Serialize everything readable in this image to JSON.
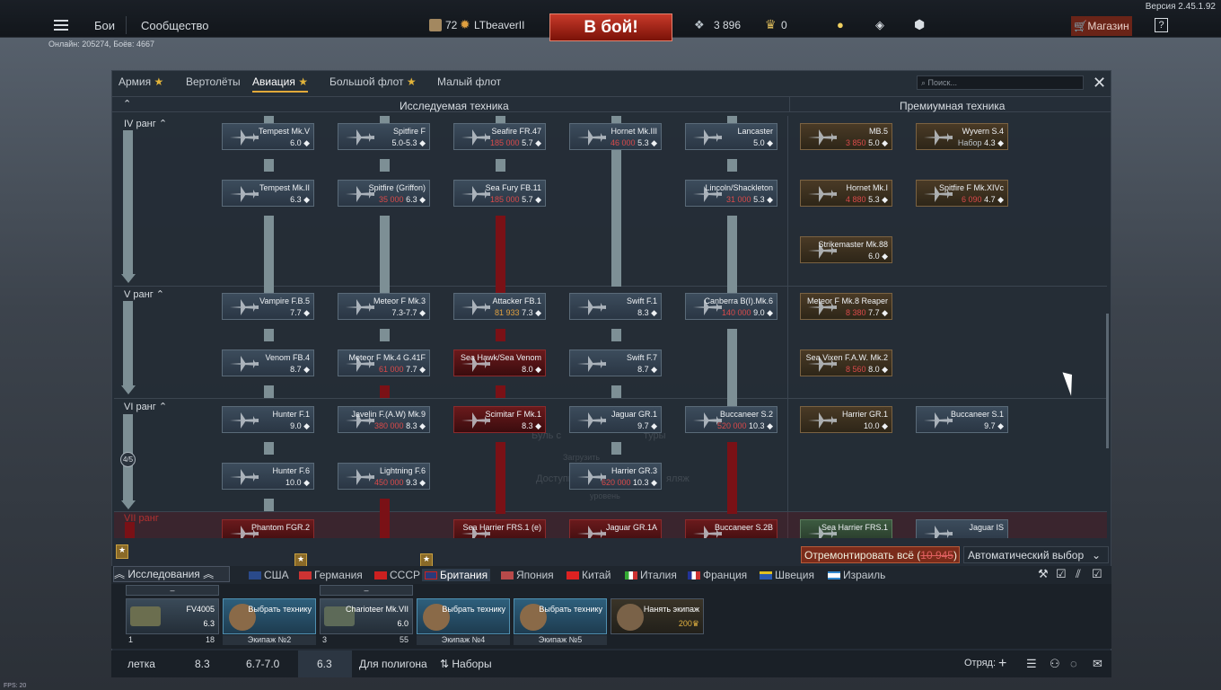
{
  "version": "Версия 2.45.1.92",
  "online": "Онлайн: 205274, Боёв: 4667",
  "topbar": {
    "battles": "Бои",
    "community": "Сообщество",
    "level": "72",
    "username": "LTbeaverII",
    "battle_button": "В бой!",
    "silver": "3 896",
    "golden_eagles": "0",
    "shop": "Магазин",
    "help": "?"
  },
  "tabs": [
    {
      "label": "Армия"
    },
    {
      "label": "Вертолёты"
    },
    {
      "label": "Авиация"
    },
    {
      "label": "Большой флот"
    },
    {
      "label": "Малый флот"
    }
  ],
  "search_placeholder": "Поиск...",
  "headers": {
    "research": "Исследуемая техника",
    "premium": "Премиумная техника"
  },
  "ranks": [
    "IV ранг",
    "V ранг",
    "VI ранг",
    "VII ранг"
  ],
  "rank_progress": "4/5",
  "cards": [
    {
      "name": "Tempest Mk.V",
      "br": "6.0 ◆"
    },
    {
      "name": "Spitfire F",
      "br": "5.0-5.3 ◆"
    },
    {
      "name": "Seafire FR.47",
      "price": "185 000",
      "br": "5.7 ◆"
    },
    {
      "name": "Hornet Mk.III",
      "price": "46 000",
      "br": "5.3 ◆"
    },
    {
      "name": "Lancaster",
      "br": "5.0 ◆"
    },
    {
      "name": "Tempest Mk.II",
      "br": "6.3 ◆"
    },
    {
      "name": "Spitfire (Griffon)",
      "price": "35 000",
      "br": "6.3 ◆"
    },
    {
      "name": "Sea Fury FB.11",
      "price": "185 000",
      "br": "5.7 ◆"
    },
    {
      "name": "Lincoln/Shackleton",
      "price": "31 000",
      "br": "5.3 ◆"
    },
    {
      "name": "Vampire F.B.5",
      "br": "7.7 ◆"
    },
    {
      "name": "Meteor F Mk.3",
      "br": "7.3-7.7 ◆"
    },
    {
      "name": "Attacker FB.1",
      "price": "81 933",
      "br": "7.3 ◆"
    },
    {
      "name": "Swift F.1",
      "br": "8.3 ◆"
    },
    {
      "name": "Canberra B(I).Mk.6",
      "price": "140 000",
      "br": "9.0 ◆"
    },
    {
      "name": "Venom FB.4",
      "br": "8.7 ◆"
    },
    {
      "name": "Meteor F Mk.4 G.41F",
      "price": "61 000",
      "br": "7.7 ◆"
    },
    {
      "name": "Sea Hawk/Sea Venom",
      "br": "8.0 ◆"
    },
    {
      "name": "Swift F.7",
      "br": "8.7 ◆"
    },
    {
      "name": "Hunter F.1",
      "br": "9.0 ◆"
    },
    {
      "name": "Javelin F.(A.W) Mk.9",
      "price": "380 000",
      "br": "8.3 ◆"
    },
    {
      "name": "Scimitar F Mk.1",
      "br": "8.3 ◆"
    },
    {
      "name": "Jaguar GR.1",
      "br": "9.7 ◆"
    },
    {
      "name": "Buccaneer S.2",
      "price": "520 000",
      "br": "10.3 ◆"
    },
    {
      "name": "Hunter F.6",
      "br": "10.0 ◆"
    },
    {
      "name": "Lightning F.6",
      "price": "450 000",
      "br": "9.3 ◆"
    },
    {
      "name": "Harrier GR.3",
      "price": "620 000",
      "br": "10.3 ◆"
    },
    {
      "name": "Phantom FGR.2"
    },
    {
      "name": "Sea Harrier FRS.1 (e)"
    },
    {
      "name": "Jaguar GR.1A"
    },
    {
      "name": "Buccaneer S.2B"
    }
  ],
  "premium_cards": [
    {
      "name": "MB.5",
      "price": "3 850",
      "br": "5.0 ◆"
    },
    {
      "name": "Wyvern S.4",
      "price": "Набор",
      "br": "4.3 ◆"
    },
    {
      "name": "Hornet Mk.I",
      "price": "4 880",
      "br": "5.3 ◆"
    },
    {
      "name": "Spitfire F Mk.XIVc",
      "price": "6 090",
      "br": "4.7 ◆"
    },
    {
      "name": "Strikemaster Mk.88",
      "br": "6.0 ◆"
    },
    {
      "name": "Meteor F Mk.8 Reaper",
      "price": "8 380",
      "br": "7.7 ◆"
    },
    {
      "name": "Sea Vixen F.A.W. Mk.2",
      "price": "8 560",
      "br": "8.0 ◆"
    },
    {
      "name": "Harrier GR.1",
      "br": "10.0 ◆"
    },
    {
      "name": "Buccaneer S.1",
      "br": "9.7 ◆"
    },
    {
      "name": "Sea Harrier FRS.1"
    },
    {
      "name": "Jaguar IS"
    }
  ],
  "ghost_text": [
    "Буль с",
    "туры",
    "Загрузить",
    "Доступно",
    "яляж",
    "уровень"
  ],
  "repair": "Отремонтировать всё",
  "repair_cost": "10 945",
  "auto_select": "Автоматический выбор",
  "research_label": "Исследования",
  "nations": [
    {
      "label": "США"
    },
    {
      "label": "Германия"
    },
    {
      "label": "СССР"
    },
    {
      "label": "Британия"
    },
    {
      "label": "Япония"
    },
    {
      "label": "Китай"
    },
    {
      "label": "Италия"
    },
    {
      "label": "Франция"
    },
    {
      "label": "Швеция"
    },
    {
      "label": "Израиль"
    }
  ],
  "slots": [
    {
      "name": "FV4005",
      "br": "6.3",
      "crew": "1",
      "level": "18",
      "sub": ""
    },
    {
      "name": "Выбрать технику",
      "sub": "Экипаж №2"
    },
    {
      "name": "Charioteer Mk.VII",
      "br": "6.0",
      "crew": "3",
      "level": "55",
      "sub": ""
    },
    {
      "name": "Выбрать технику",
      "sub": "Экипаж №4"
    },
    {
      "name": "Выбрать технику",
      "sub": "Экипаж №5"
    },
    {
      "name": "Нанять экипаж",
      "price": "200"
    }
  ],
  "bottombar": {
    "mode": "летка",
    "br1": "8.3",
    "br2": "6.7-7.0",
    "br3": "6.3",
    "training": "Для полигона",
    "presets": "Наборы",
    "squad": "Отряд:"
  },
  "fps": "FPS: 20",
  "colors": {
    "accent": "#e1a93a",
    "battle": "#c83a2a",
    "research_line": "#7d8f95",
    "premium_line": "#7a1116"
  }
}
